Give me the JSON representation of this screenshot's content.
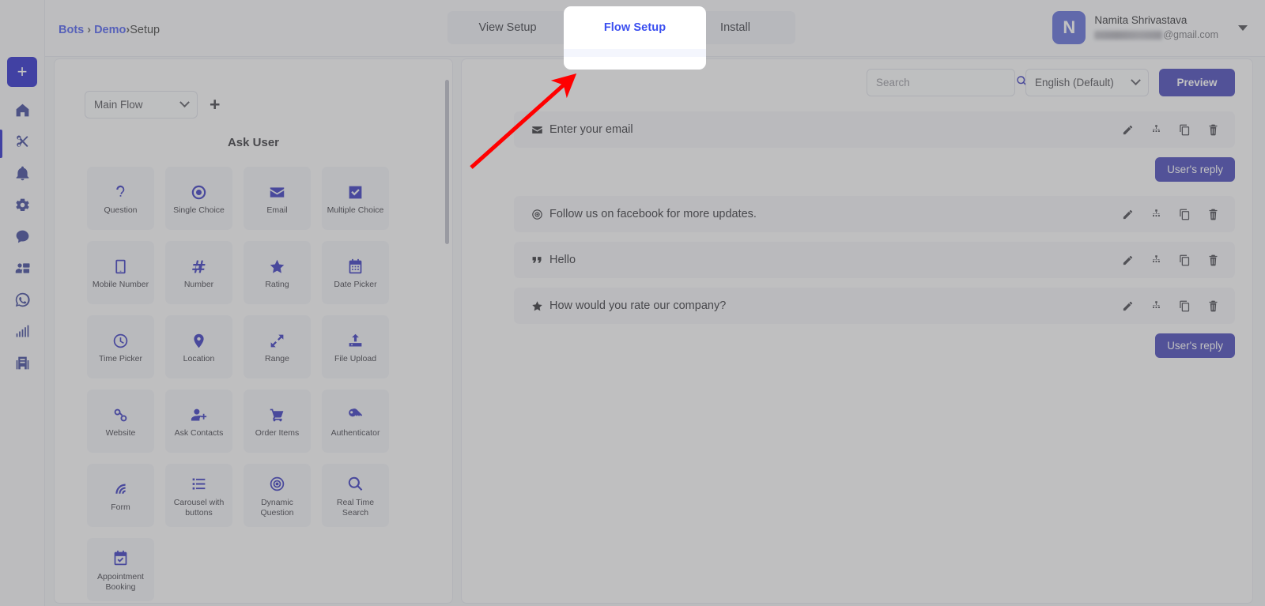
{
  "breadcrumb": {
    "root": "Bots",
    "sep": "›",
    "parent": "Demo",
    "sep2": "›",
    "current": "Setup"
  },
  "tabs": [
    {
      "label": "View Setup",
      "active": false
    },
    {
      "label": "Flow Setup",
      "active": true
    },
    {
      "label": "Install",
      "active": false
    }
  ],
  "spotlight": {
    "label": "Flow Setup"
  },
  "user": {
    "initial": "N",
    "name": "Namita Shrivastava",
    "email_domain": "@gmail.com"
  },
  "rail": {
    "add_label": "+",
    "items": [
      {
        "name": "home",
        "active": false
      },
      {
        "name": "tools",
        "active": true
      },
      {
        "name": "bell",
        "active": false
      },
      {
        "name": "gear",
        "active": false
      },
      {
        "name": "chat",
        "active": false
      },
      {
        "name": "contacts",
        "active": false
      },
      {
        "name": "whatsapp",
        "active": false
      },
      {
        "name": "analytics",
        "active": false
      },
      {
        "name": "ai-building",
        "active": false
      }
    ]
  },
  "palette": {
    "flow_select_value": "Main Flow",
    "add_flow_label": "+",
    "section_title": "Ask User",
    "widgets": [
      {
        "label": "Question",
        "icon": "question-icon"
      },
      {
        "label": "Single Choice",
        "icon": "radio-icon"
      },
      {
        "label": "Email",
        "icon": "envelope-icon"
      },
      {
        "label": "Multiple Choice",
        "icon": "checkbox-icon"
      },
      {
        "label": "Mobile Number",
        "icon": "phone-icon"
      },
      {
        "label": "Number",
        "icon": "hash-icon"
      },
      {
        "label": "Rating",
        "icon": "star-icon"
      },
      {
        "label": "Date Picker",
        "icon": "calendar-icon"
      },
      {
        "label": "Time Picker",
        "icon": "clock-icon"
      },
      {
        "label": "Location",
        "icon": "map-pin-icon"
      },
      {
        "label": "Range",
        "icon": "expand-arrows-icon"
      },
      {
        "label": "File Upload",
        "icon": "upload-icon"
      },
      {
        "label": "Website",
        "icon": "link-icon"
      },
      {
        "label": "Ask Contacts",
        "icon": "user-plus-icon"
      },
      {
        "label": "Order Items",
        "icon": "cart-icon"
      },
      {
        "label": "Authenticator",
        "icon": "key-icon"
      },
      {
        "label": "Form",
        "icon": "form-icon"
      },
      {
        "label": "Carousel with buttons",
        "icon": "list-icon"
      },
      {
        "label": "Dynamic Question",
        "icon": "target-icon"
      },
      {
        "label": "Real Time Search",
        "icon": "magnifier-icon"
      },
      {
        "label": "Appointment Booking",
        "icon": "calendar-check-icon"
      }
    ]
  },
  "canvas": {
    "search_placeholder": "Search",
    "search_value": "",
    "language_value": "English (Default)",
    "preview_label": "Preview",
    "reply_badge_label": "User's reply",
    "actions": [
      "edit",
      "branch",
      "duplicate",
      "delete"
    ],
    "rows": [
      {
        "text": "Enter your email",
        "icon": "envelope-icon",
        "reply_after": true
      },
      {
        "text": "Follow us on facebook for more updates.",
        "icon": "target-icon",
        "reply_after": false
      },
      {
        "text": "Hello",
        "icon": "quote-icon",
        "reply_after": false
      },
      {
        "text": "How would you rate our company?",
        "icon": "star-icon",
        "reply_after": true
      }
    ]
  },
  "colors": {
    "accent": "#3232b4",
    "brand_blue": "#1414c8",
    "tab_active_text": "#3b4ff0",
    "annotation_red": "#ff0000"
  }
}
